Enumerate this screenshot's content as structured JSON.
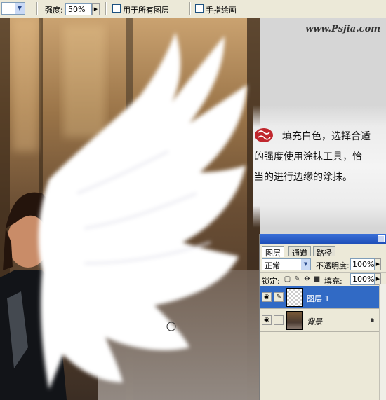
{
  "options_bar": {
    "strength_label": "强度:",
    "strength_value": "50%",
    "sample_all_layers_label": "用于所有图层",
    "finger_painting_label": "手指绘画"
  },
  "logo": "www.Psjia.com",
  "instruction": {
    "line1": "填充白色，选择合适",
    "line2": "的强度使用涂抹工具，恰",
    "line3": "当的进行边缘的涂抹。"
  },
  "layers_panel": {
    "tabs": [
      {
        "label": "图层"
      },
      {
        "label": "通道"
      },
      {
        "label": "路径"
      }
    ],
    "blend_mode": "正常",
    "opacity_label": "不透明度:",
    "opacity_value": "100%",
    "lock_label": "锁定:",
    "fill_label": "填充:",
    "fill_value": "100%",
    "layers": [
      {
        "name": "图层 1",
        "selected": true,
        "visible": true
      },
      {
        "name": "背景",
        "selected": false,
        "visible": true,
        "locked": true
      }
    ]
  },
  "colors": {
    "selection_blue": "#316ac5",
    "titlebar_blue": "#1e4fb8",
    "seal_red": "#c0272d",
    "panel_bg": "#ece9d8"
  }
}
